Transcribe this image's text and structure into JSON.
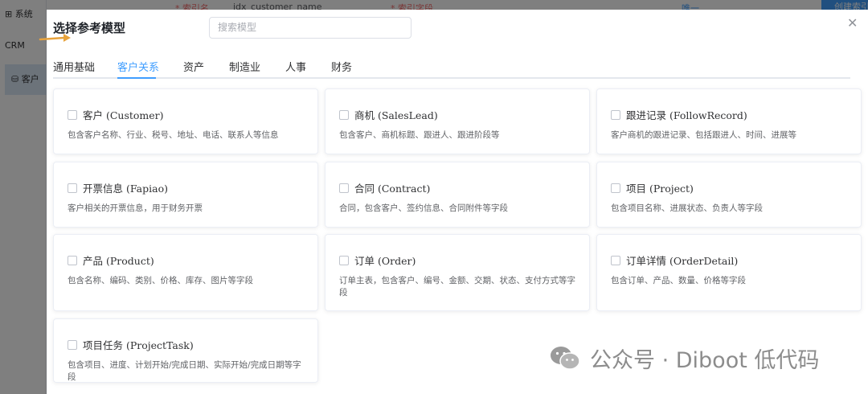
{
  "background": {
    "sidebar": {
      "items": [
        {
          "icon": "grid-icon",
          "label": "系统"
        },
        {
          "label": "CRM"
        },
        {
          "icon": "database-icon",
          "label": "客户"
        }
      ]
    },
    "topbar": {
      "index_name_label": "* 索引名",
      "index_name_value": "idx_customer_name",
      "index_field_label": "* 索引字段",
      "unique_label": "唯一",
      "create_index_button": "创建索引"
    }
  },
  "dialog": {
    "title": "选择参考模型",
    "search_placeholder": "搜索模型",
    "tabs": [
      {
        "label": "通用基础",
        "active": false
      },
      {
        "label": "客户关系",
        "active": true
      },
      {
        "label": "资产",
        "active": false
      },
      {
        "label": "制造业",
        "active": false
      },
      {
        "label": "人事",
        "active": false
      },
      {
        "label": "财务",
        "active": false
      }
    ],
    "models": [
      {
        "title": "客户 (Customer)",
        "desc": "包含客户名称、行业、税号、地址、电话、联系人等信息"
      },
      {
        "title": "商机 (SalesLead)",
        "desc": "包含客户、商机标题、跟进人、跟进阶段等"
      },
      {
        "title": "跟进记录 (FollowRecord)",
        "desc": "客户商机的跟进记录、包括跟进人、时间、进展等"
      },
      {
        "title": "开票信息 (Fapiao)",
        "desc": "客户相关的开票信息，用于财务开票"
      },
      {
        "title": "合同 (Contract)",
        "desc": "合同，包含客户、签约信息、合同附件等字段"
      },
      {
        "title": "项目 (Project)",
        "desc": "包含项目名称、进展状态、负责人等字段"
      },
      {
        "title": "产品 (Product)",
        "desc": "包含名称、编码、类别、价格、库存、图片等字段"
      },
      {
        "title": "订单 (Order)",
        "desc": "订单主表，包含客户、编号、金额、交期、状态、支付方式等字段"
      },
      {
        "title": "订单详情 (OrderDetail)",
        "desc": "包含订单、产品、数量、价格等字段"
      },
      {
        "title": "项目任务 (ProjectTask)",
        "desc": "包含项目、进度、计划开始/完成日期、实际开始/完成日期等字段"
      }
    ]
  },
  "watermark": {
    "icon": "wechat-icon",
    "text": "公众号 · Diboot 低代码"
  }
}
